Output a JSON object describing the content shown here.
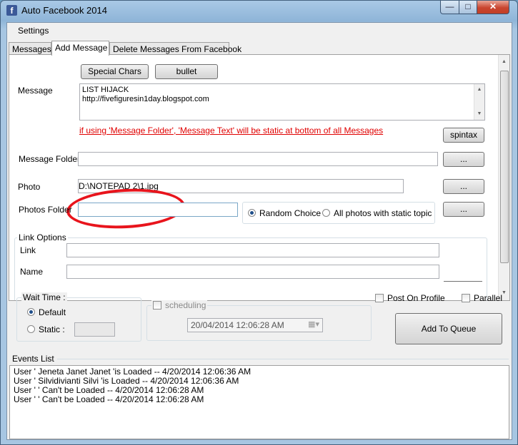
{
  "window": {
    "title": "Auto Facebook 2014",
    "app_icon": "facebook-icon",
    "controls": {
      "minimize": "—",
      "maximize": "□",
      "close": "✕"
    }
  },
  "menubar": {
    "settings": "Settings"
  },
  "tabs": [
    {
      "label": "Messages",
      "active": false
    },
    {
      "label": "Add Message",
      "active": true
    },
    {
      "label": "Delete Messages From Facebook",
      "active": false
    }
  ],
  "add_message": {
    "special_chars_button": "Special Chars",
    "bullet_button": "bullet",
    "message_label": "Message",
    "message_lines": [
      "LIST HIJACK",
      "http://fivefiguresin1day.blogspot.com"
    ],
    "warning_text": "if using 'Message Folder', 'Message Text' will be static at bottom of all Messages",
    "spintax_button": "spintax",
    "message_folder_label": "Message Folder",
    "message_folder_value": "",
    "browse_label": "...",
    "photo_label": "Photo",
    "photo_value": "D:\\NOTEPAD 2\\1.jpg",
    "photos_folder_label": "Photos Folder",
    "photos_folder_value": "",
    "random_choice_label": "Random Choice",
    "all_photos_label": "All photos with static topic",
    "photo_mode_selected": "Random Choice",
    "link_options_title": "Link Options",
    "link_label": "Link",
    "link_value": "",
    "name_label": "Name",
    "name_value": ""
  },
  "bottom": {
    "wait_time_title": "Wait Time :",
    "default_label": "Default",
    "static_label": "Static :",
    "static_value": "",
    "wait_selected": "Default",
    "scheduling_label": "scheduling",
    "scheduling_checked": false,
    "schedule_datetime": "20/04/2014 12:06:28 AM",
    "post_on_profile_label": "Post On Profile",
    "post_on_profile_checked": false,
    "parallel_label": "Parallel",
    "parallel_checked": false,
    "add_to_queue_button": "Add To Queue"
  },
  "events": {
    "title": "Events List",
    "lines": [
      "User ' Jeneta Janet Janet 'is Loaded  --  4/20/2014 12:06:36 AM",
      "User ' Silvidivianti Silvi 'is Loaded  --  4/20/2014 12:06:36 AM",
      "User '  ' Can't be Loaded  --  4/20/2014 12:06:28 AM",
      "User '  ' Can't be Loaded  --  4/20/2014 12:06:28 AM"
    ]
  },
  "colors": {
    "annotation_circle": "#e8141c",
    "warning_text": "#e00000",
    "facebook_blue": "#3b5998"
  }
}
